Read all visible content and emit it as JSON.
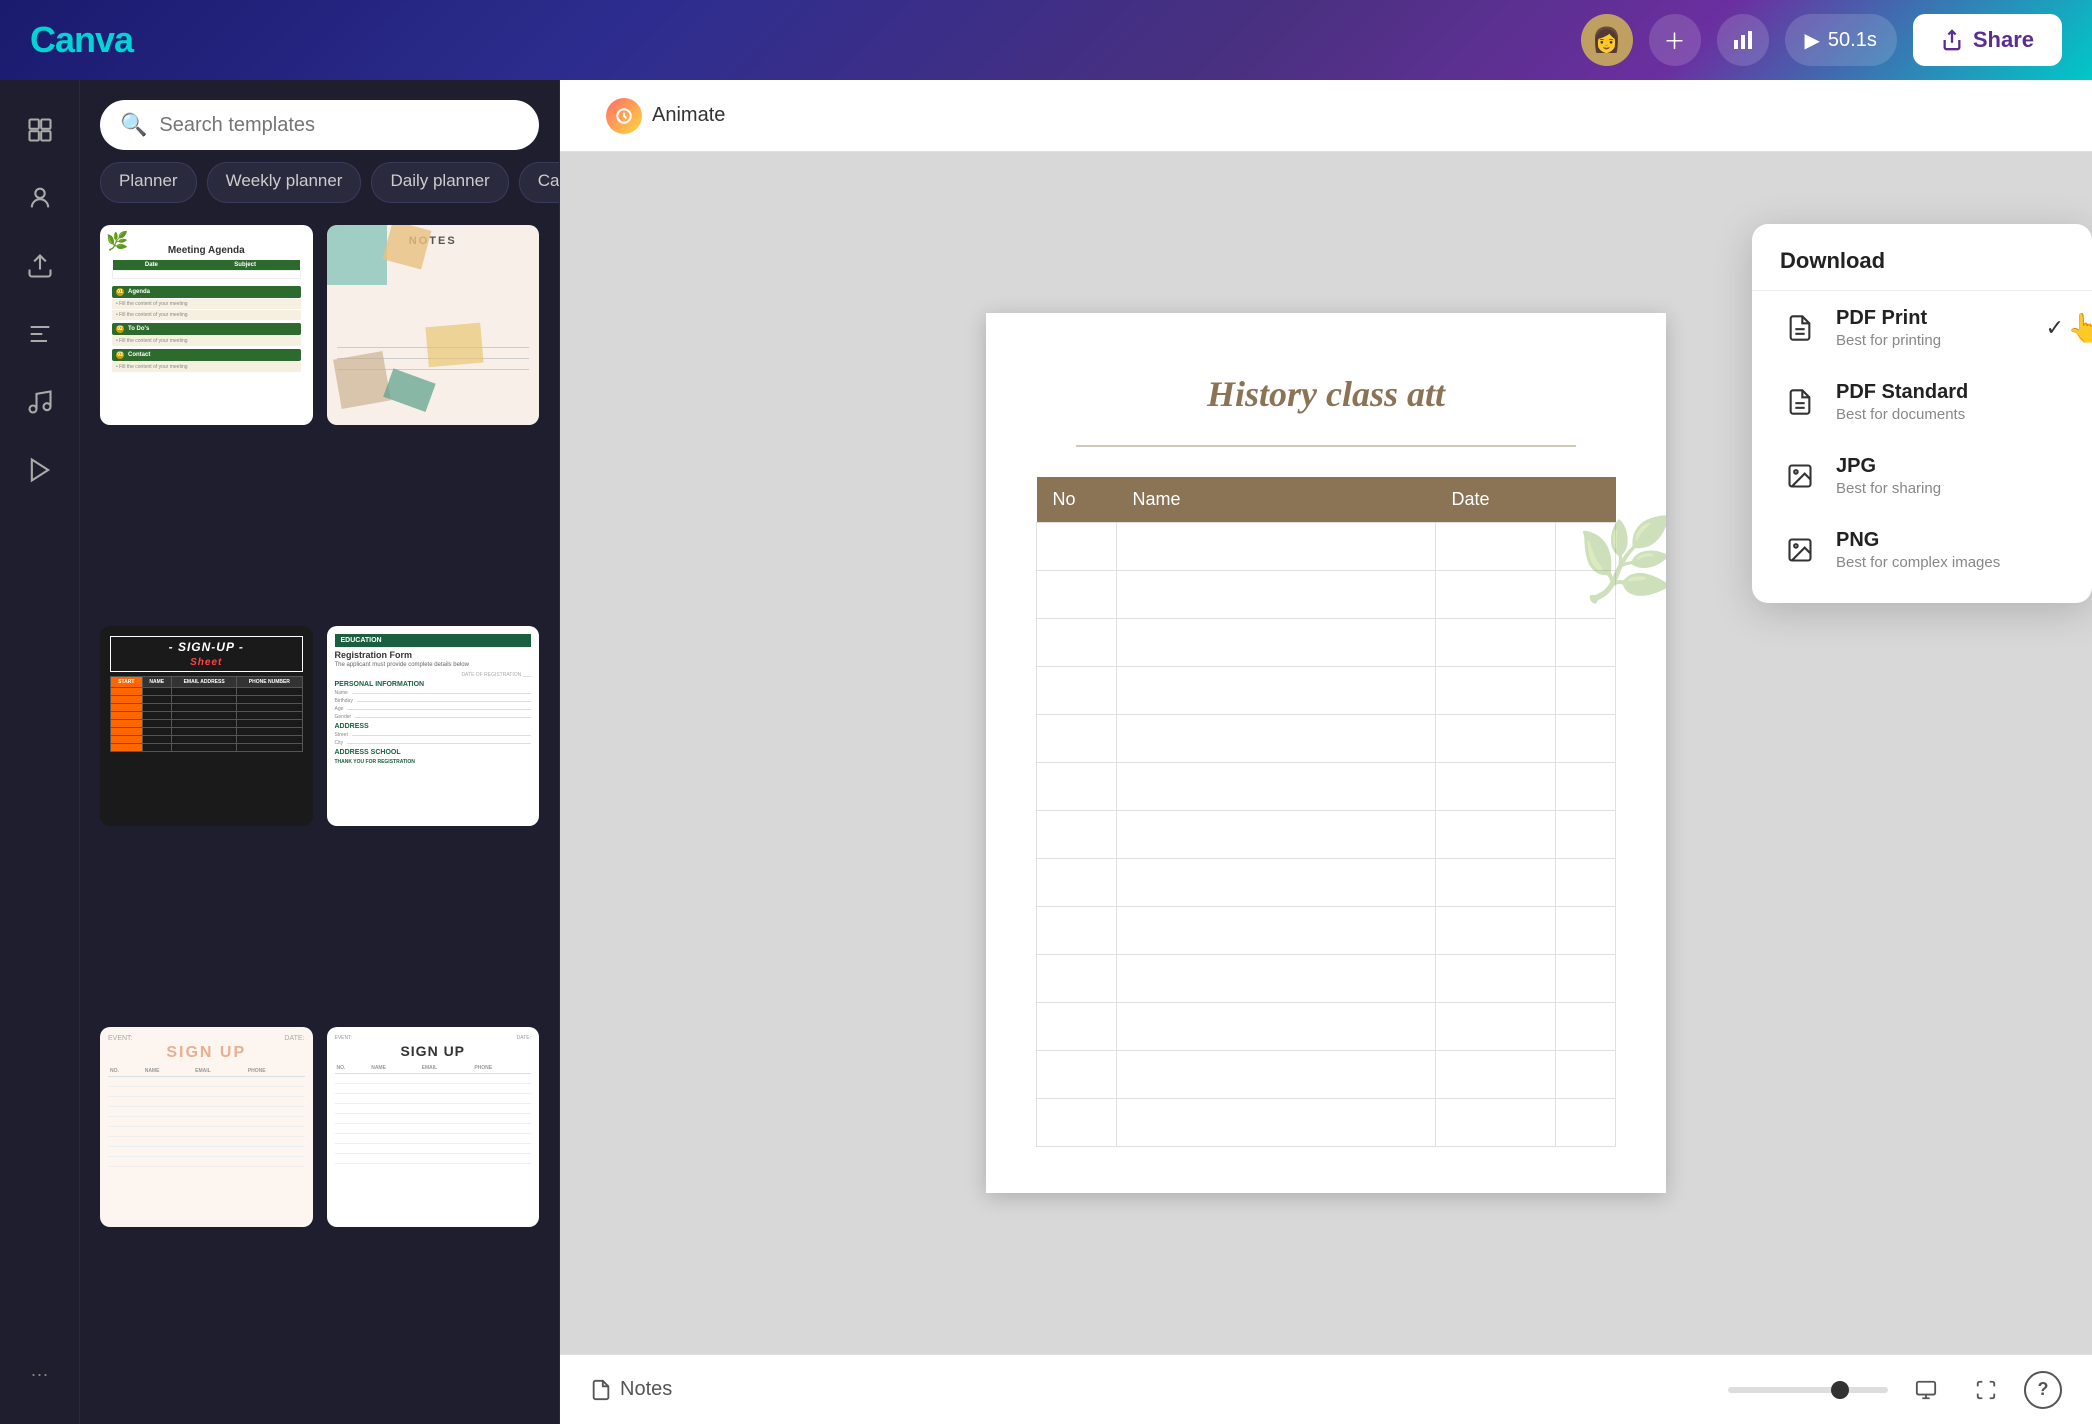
{
  "header": {
    "logo": "Canva",
    "play_label": "50.1s",
    "share_label": "Share"
  },
  "search": {
    "placeholder": "Search templates"
  },
  "filter_tags": [
    {
      "id": "planner",
      "label": "Planner"
    },
    {
      "id": "weekly",
      "label": "Weekly planner"
    },
    {
      "id": "daily",
      "label": "Daily planner"
    },
    {
      "id": "calendar",
      "label": "Calend..."
    },
    {
      "id": "more",
      "label": "›"
    }
  ],
  "templates": [
    {
      "id": "meeting-agenda",
      "name": "Meeting Agenda"
    },
    {
      "id": "notes",
      "name": "Notes"
    },
    {
      "id": "signup-sheet",
      "name": "Sign-Up Sheet"
    },
    {
      "id": "registration-form",
      "name": "Registration Form"
    },
    {
      "id": "signup-pink",
      "name": "Sign Up (Pink)"
    },
    {
      "id": "signup-minimal",
      "name": "Sign Up (Minimal)"
    }
  ],
  "toolbar": {
    "animate_label": "Animate"
  },
  "canvas": {
    "doc_title": "History class att",
    "table_headers": [
      "No",
      "Name",
      "Date"
    ],
    "notes_label": "Notes"
  },
  "dropdown": {
    "title": "Download",
    "items": [
      {
        "id": "pdf-print",
        "title": "PDF Print",
        "subtitle": "Best for printing",
        "selected": true
      },
      {
        "id": "pdf-standard",
        "title": "PDF Standard",
        "subtitle": "Best for documents",
        "selected": false
      },
      {
        "id": "jpg",
        "title": "JPG",
        "subtitle": "Best for sharing",
        "selected": false
      },
      {
        "id": "png",
        "title": "PNG",
        "subtitle": "Best for complex images",
        "selected": false
      }
    ]
  },
  "sidebar_icons": [
    {
      "id": "templates",
      "icon": "⊞"
    },
    {
      "id": "elements",
      "icon": "✦"
    },
    {
      "id": "upload",
      "icon": "⬆"
    },
    {
      "id": "text",
      "icon": "T"
    },
    {
      "id": "audio",
      "icon": "♪"
    },
    {
      "id": "video",
      "icon": "▶"
    }
  ]
}
